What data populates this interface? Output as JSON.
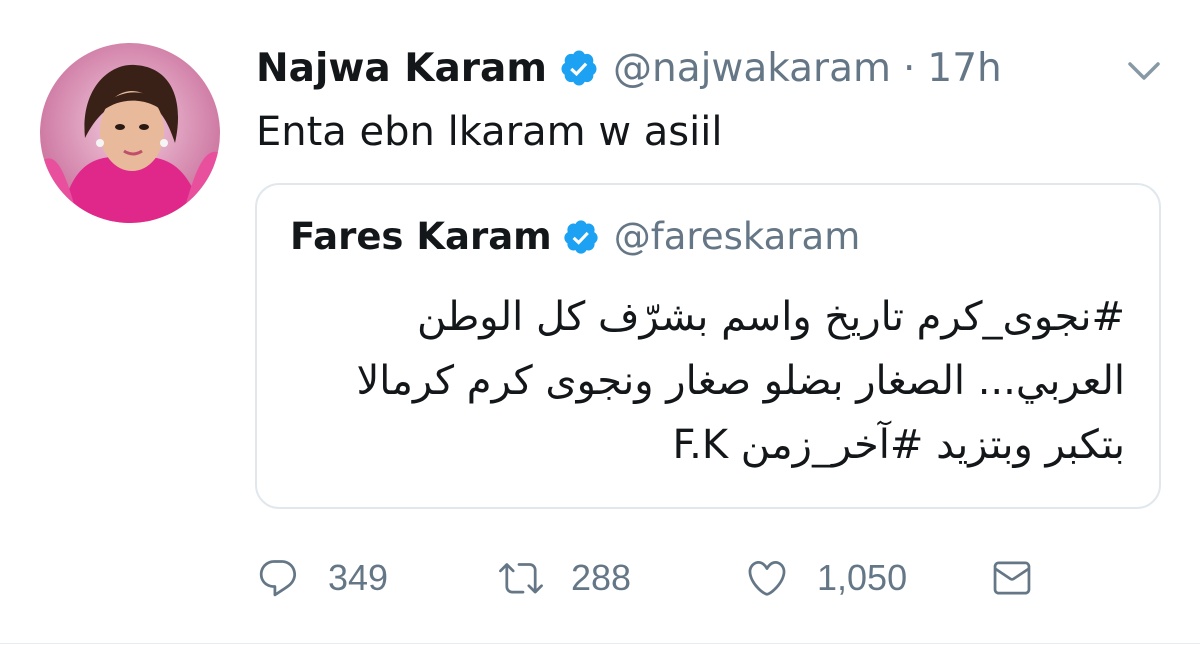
{
  "tweet": {
    "author": {
      "name": "Najwa Karam",
      "handle": "@najwakaram",
      "verified": true,
      "avatar": "profile-photo"
    },
    "separator": "·",
    "time": "17h",
    "text": "Enta ebn lkaram w asiil",
    "menu_icon": "chevron-down-icon"
  },
  "quoted": {
    "author": {
      "name": "Fares Karam",
      "handle": "@fareskaram",
      "verified": true
    },
    "lines": [
      "#نجوى_كرم تاريخ واسم بشرّف كل الوطن",
      "العربي... الصغار بضلو صغار ونجوى كرم كرمالا",
      "بتكبر وبتزيد #آخر_زمن F.K"
    ]
  },
  "actions": {
    "reply": {
      "icon": "reply-icon",
      "count": "349"
    },
    "retweet": {
      "icon": "retweet-icon",
      "count": "288"
    },
    "like": {
      "icon": "heart-icon",
      "count": "1,050"
    },
    "dm": {
      "icon": "mail-icon"
    }
  },
  "colors": {
    "text": "#14171a",
    "secondary": "#657786",
    "verified": "#1da1f2",
    "border": "#e1e8ed"
  }
}
